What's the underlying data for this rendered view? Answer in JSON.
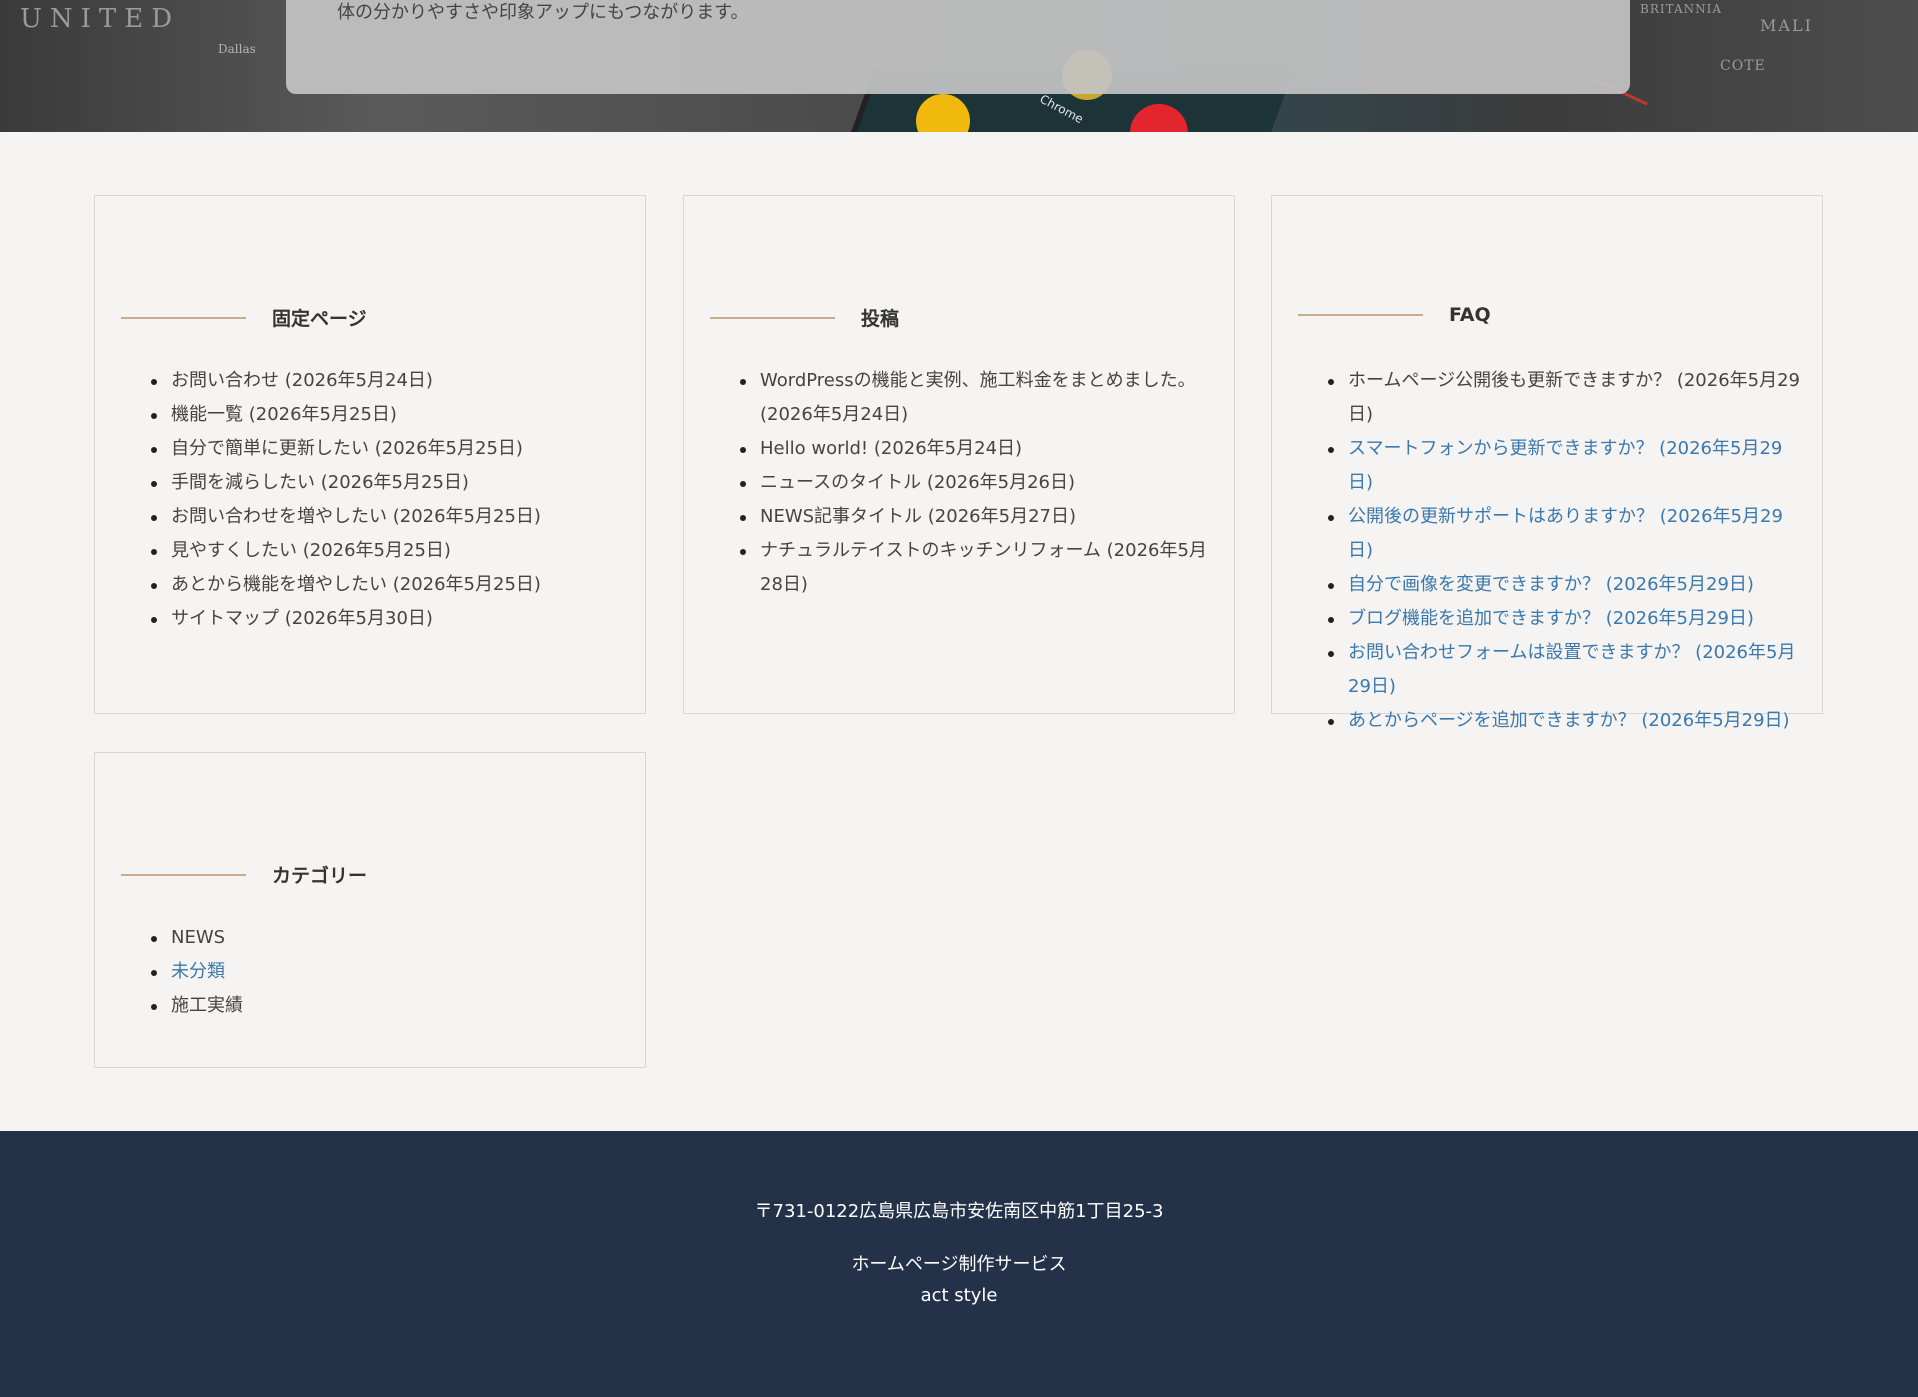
{
  "hero": {
    "text": "体の分かりやすさや印象アップにもつながります。",
    "map_labels": [
      "UNITED",
      "Dallas",
      "BRITANNIA",
      "MALI",
      "COTE"
    ],
    "app_label": "Chrome"
  },
  "widgets": {
    "pages": {
      "title": "固定ページ",
      "items": [
        "お問い合わせ (2026年5月24日)",
        "機能一覧 (2026年5月25日)",
        "自分で簡単に更新したい (2026年5月25日)",
        "手間を減らしたい (2026年5月25日)",
        "お問い合わせを増やしたい (2026年5月25日)",
        "見やすくしたい (2026年5月25日)",
        "あとから機能を増やしたい (2026年5月25日)",
        "サイトマップ (2026年5月30日)"
      ]
    },
    "posts": {
      "title": "投稿",
      "items": [
        "WordPressの機能と実例、施工料金をまとめました。 (2026年5月24日)",
        "Hello world! (2026年5月24日)",
        "ニュースのタイトル (2026年5月26日)",
        "NEWS記事タイトル (2026年5月27日)",
        "ナチュラルテイストのキッチンリフォーム (2026年5月28日)"
      ]
    },
    "faq": {
      "title": "FAQ",
      "items": [
        "ホームページ公開後も更新できますか？ (2026年5月29日)",
        "スマートフォンから更新できますか？ (2026年5月29日)",
        "公開後の更新サポートはありますか？ (2026年5月29日)",
        "自分で画像を変更できますか？ (2026年5月29日)",
        "ブログ機能を追加できますか？ (2026年5月29日)",
        "お問い合わせフォームは設置できますか？ (2026年5月29日)",
        "あとからページを追加できますか？ (2026年5月29日)"
      ]
    },
    "categories": {
      "title": "カテゴリー",
      "items": [
        "NEWS",
        "未分類",
        "施工実績"
      ]
    }
  },
  "footer": {
    "address": "〒731-0122広島県広島市安佐南区中筋1丁目25-3",
    "service": "ホームページ制作サービス",
    "brand": "act style"
  },
  "colors": {
    "background": "#f5f4f2",
    "accent_rule": "#c7ab8c",
    "link": "#3a78ad",
    "footer": "#243249"
  }
}
